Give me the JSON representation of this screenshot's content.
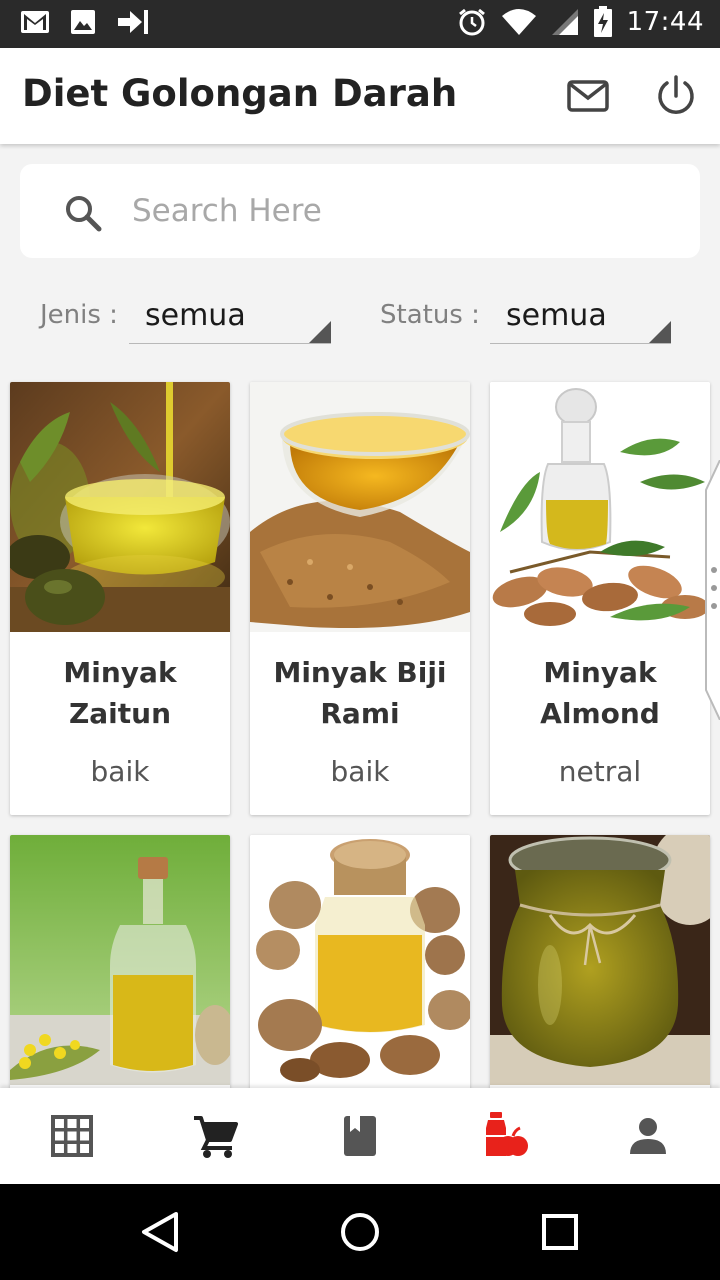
{
  "status_bar": {
    "time": "17:44",
    "left_icons": [
      "gmail-icon",
      "image-icon",
      "signin-arrow-icon"
    ],
    "right_icons": [
      "alarm-icon",
      "wifi-icon",
      "signal-icon",
      "battery-charging-icon"
    ]
  },
  "app_bar": {
    "title": "Diet Golongan Darah",
    "actions": [
      "mail-icon",
      "power-icon"
    ]
  },
  "search": {
    "placeholder": "Search Here",
    "value": ""
  },
  "filters": {
    "jenis": {
      "label": "Jenis :",
      "value": "semua"
    },
    "status": {
      "label": "Status :",
      "value": "semua"
    }
  },
  "items": [
    {
      "name": "Minyak Zaitun",
      "status": "baik"
    },
    {
      "name": "Minyak Biji Rami",
      "status": "baik"
    },
    {
      "name": "Minyak Almond",
      "status": "netral"
    },
    {
      "name": "",
      "status": ""
    },
    {
      "name": "",
      "status": ""
    },
    {
      "name": "",
      "status": ""
    }
  ],
  "bottom_nav": {
    "items": [
      "grid-icon",
      "cart-icon",
      "book-icon",
      "food-icon",
      "person-icon"
    ],
    "active": "food-icon"
  },
  "colors": {
    "accent": "#e8221b",
    "title": "#222222",
    "background": "#f3f3f3",
    "status_bar": "#2a2a2a"
  }
}
